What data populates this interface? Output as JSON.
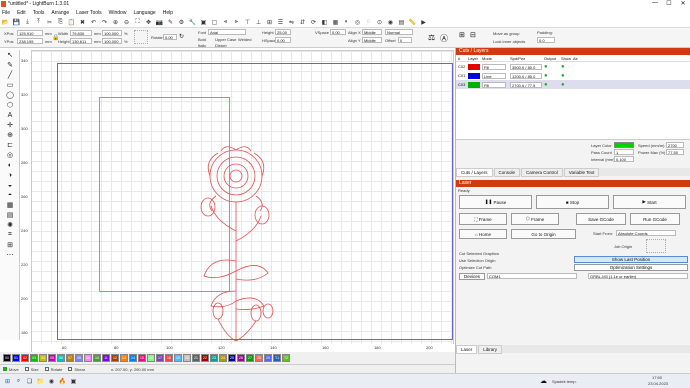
{
  "window": {
    "title": "*untitled* - LightBurn 1.3.01",
    "min": "—",
    "max": "☐",
    "close": "✕"
  },
  "menu": [
    "File",
    "Edit",
    "Tools",
    "Arrange",
    "Laser Tools",
    "Window",
    "Language",
    "Help"
  ],
  "toolbar2": {
    "xpos_label": "XPos",
    "xpos": "125.910",
    "ypos_label": "YPos",
    "ypos": "238.195",
    "width_label": "Width",
    "width": "79.830",
    "height_label": "Height",
    "height": "130.611",
    "wpct": "100.000",
    "hpct": "100.000",
    "unit": "mm",
    "pct": "%",
    "rotate_label": "Rotate",
    "rotate": "0.00",
    "font_label": "Font",
    "font": "Arial",
    "bold": "Bold",
    "italic": "Italic",
    "upper": "Upper Case",
    "welded": "Welded",
    "distort": "Distort",
    "hspace_label": "HSpace",
    "hspace": "0.00",
    "vspace_label": "VSpace",
    "vspace": "0.00",
    "fontheight_label": "Height",
    "fontheight": "25.00",
    "alignx_label": "Align X",
    "alignx": "Middle",
    "aligny_label": "Align Y",
    "aligny": "Middle",
    "normal": "Normal",
    "offset_label": "Offset",
    "offset": "0",
    "move_group": "Move as group",
    "lock_inner": "Lock inner objects",
    "padding_label": "Padding:",
    "padding": "0.0"
  },
  "rulers": {
    "left": [
      "340",
      "320",
      "300",
      "280",
      "260",
      "240",
      "220",
      "200",
      "180"
    ],
    "bottom": [
      "60",
      "80",
      "100",
      "120",
      "140",
      "160",
      "180",
      "200"
    ]
  },
  "palette": [
    "00",
    "01",
    "02",
    "03",
    "04",
    "05",
    "06",
    "07",
    "08",
    "09",
    "10",
    "11",
    "12",
    "13",
    "14",
    "15",
    "16",
    "17",
    "18",
    "19",
    "20",
    "21",
    "22",
    "23",
    "24",
    "25",
    "26",
    "27",
    "28",
    "29",
    "T1",
    "T2"
  ],
  "palette_colors": [
    "#000000",
    "#0000ff",
    "#ff0000",
    "#00c000",
    "#c0c000",
    "#c000c0",
    "#00c0c0",
    "#c08000",
    "#8080ff",
    "#ff80ff",
    "#40a040",
    "#8000ff",
    "#a04000",
    "#ff8000",
    "#0080ff",
    "#ff0080",
    "#80ff80",
    "#8040c0",
    "#ff4040",
    "#40c0ff",
    "#c0c0c0",
    "#606060",
    "#a00000",
    "#00a0a0",
    "#a0a000",
    "#0000a0",
    "#a000a0",
    "#00a000",
    "#ff6060",
    "#6060ff",
    "#2060c0",
    "#60c020"
  ],
  "status": {
    "move": "Move",
    "size": "Size",
    "rotate": "Rotate",
    "shear": "Shear",
    "coords": "x: 207.00, y: 290.00 mm"
  },
  "taskbar": {
    "weather": "Spadek temp.",
    "time": "17:50",
    "date": "23.04.2023"
  },
  "cuts": {
    "title": "Cuts / Layers",
    "headers": [
      "#",
      "Layer",
      "Mode",
      "Spd/Pwr",
      "Output",
      "Show",
      "Air"
    ],
    "rows": [
      {
        "num": "C02",
        "mode": "Fill",
        "spd": "3500.0 / 80.0",
        "color": "#e00000"
      },
      {
        "num": "C01",
        "mode": "Line",
        "spd": "1200.0 / 85.0",
        "color": "#0000e0"
      },
      {
        "num": "C03",
        "mode": "Fill",
        "spd": "2700.0 / 77.5",
        "color": "#00b000"
      }
    ],
    "layer_color_label": "Layer Color",
    "speed_label": "Speed (mm/m)",
    "speed": "2700",
    "pass_label": "Pass Count",
    "pass": "1",
    "power_label": "Power Max (%)",
    "power": "77.50",
    "interval_label": "Interval (mm)",
    "interval": "0.100"
  },
  "tabs1": [
    "Cuts / Layers",
    "Console",
    "Camera Control",
    "Variable Text"
  ],
  "laser": {
    "title": "Laser",
    "ready": "Ready",
    "pause": "Pause",
    "stop": "Stop",
    "start": "Start",
    "frame1": "Frame",
    "frame2": "Frame",
    "save_gcode": "Save GCode",
    "run_gcode": "Run GCode",
    "home": "Home",
    "go_origin": "Go to Origin",
    "start_from_label": "Start From:",
    "start_from": "Absolute Coords",
    "job_origin": "Job Origin",
    "cut_selected": "Cut Selected Graphics",
    "use_selection": "Use Selection Origin",
    "optimize": "Optimize Cut Path",
    "show_last": "Show Last Position",
    "opt_settings": "Optimization Settings",
    "devices": "Devices",
    "port": "COM1",
    "device": "GRBL-M3 (1.1e or earlier)"
  },
  "tabs2": [
    "Laser",
    "Library"
  ]
}
